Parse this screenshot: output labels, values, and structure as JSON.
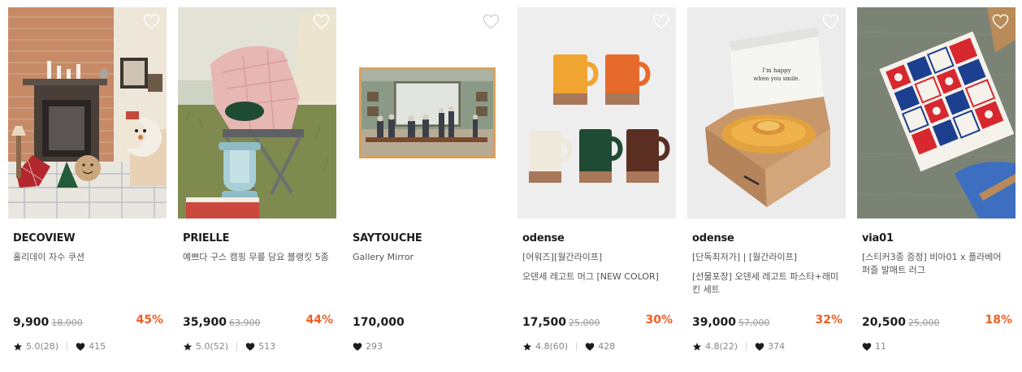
{
  "products": [
    {
      "brand": "DECOVIEW",
      "desc": [
        "홀리데이 자수 쿠션"
      ],
      "price": "9,900",
      "orig": "18,000",
      "discount": "45%",
      "rating": "5.0(28)",
      "likes": "415",
      "image": "fireplace-scene-image"
    },
    {
      "brand": "PRIELLE",
      "desc": [
        "예쁘다 구스 캠핑 무릎 담요 블랭킷 5종"
      ],
      "price": "35,900",
      "orig": "63,900",
      "discount": "44%",
      "rating": "5.0(52)",
      "likes": "513",
      "image": "camping-chair-blanket-image"
    },
    {
      "brand": "SAYTOUCHE",
      "desc": [
        "Gallery Mirror"
      ],
      "price": "170,000",
      "orig": "",
      "discount": "",
      "rating": "",
      "likes": "293",
      "image": "gallery-mirror-image"
    },
    {
      "brand": "odense",
      "desc": [
        "[어워즈][월간라이프]",
        "오덴세 레고트 머그 [NEW COLOR]"
      ],
      "price": "17,500",
      "orig": "25,000",
      "discount": "30%",
      "rating": "4.8(60)",
      "likes": "428",
      "image": "colored-mugs-image"
    },
    {
      "brand": "odense",
      "desc": [
        "[단독최저가] | [월간라이프]",
        "[선물포장] 오덴세 레고트 파스타+래미킨 세트"
      ],
      "price": "39,000",
      "orig": "57,000",
      "discount": "32%",
      "rating": "4.8(22)",
      "likes": "374",
      "image": "gift-box-plate-image",
      "box_text": [
        "I'm happy",
        "when you smile."
      ]
    },
    {
      "brand": "via01",
      "desc": [
        "[스티커3종 증정] 비아01 x 플라베어 퍼즐 발매트 러그"
      ],
      "price": "20,500",
      "orig": "25,000",
      "discount": "18%",
      "rating": "",
      "likes": "11",
      "image": "puzzle-rug-image"
    }
  ],
  "colors": {
    "discount": "#f05d23",
    "price": "#1c1c1c",
    "meta": "#888888"
  }
}
